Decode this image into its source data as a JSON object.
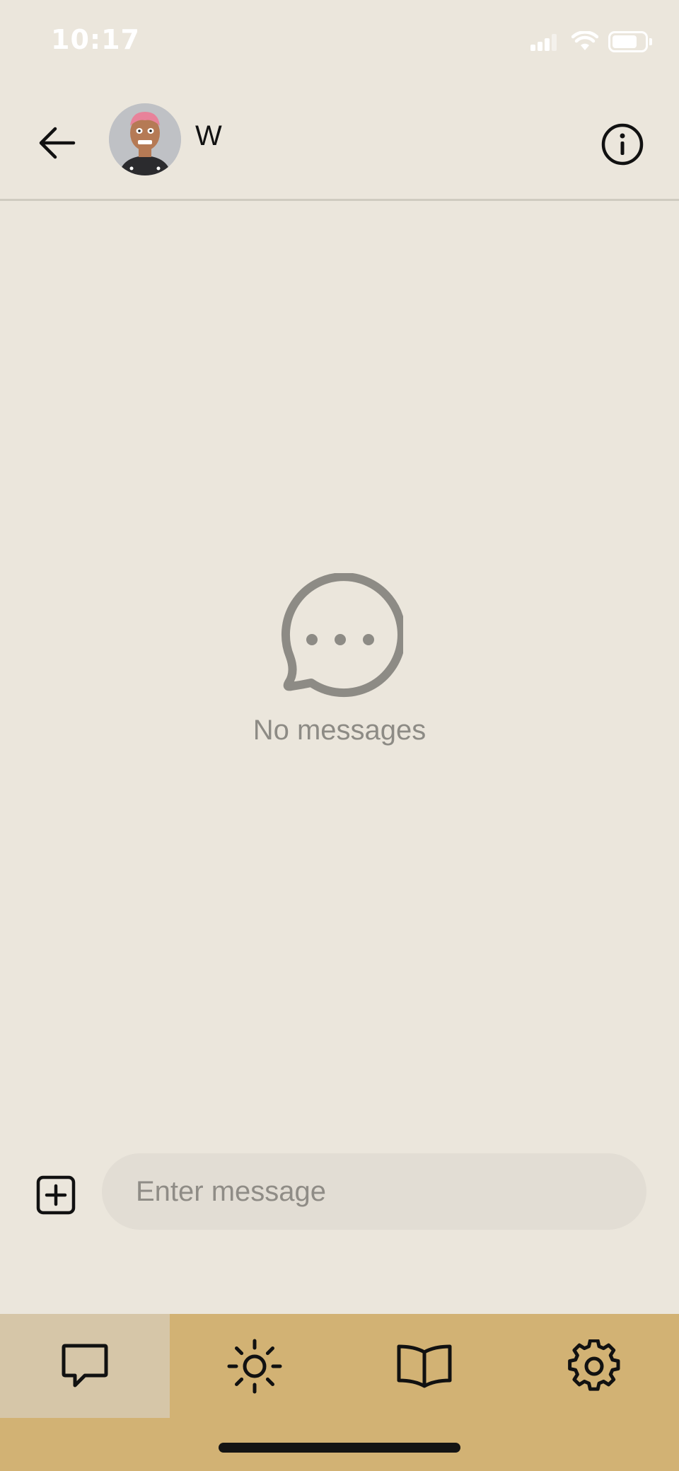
{
  "status_bar": {
    "time": "10:17",
    "signal_icon": "cellular-signal-icon",
    "wifi_icon": "wifi-icon",
    "battery_icon": "battery-icon",
    "status_color": "#ffffff"
  },
  "header": {
    "back_icon": "arrow-left-icon",
    "contact_name": "W",
    "avatar": "contact-avatar",
    "info_icon": "info-circle-icon"
  },
  "empty_state": {
    "icon": "chat-bubble-dots-icon",
    "label": "No messages"
  },
  "composer": {
    "attach_icon": "plus-square-icon",
    "placeholder": "Enter message",
    "value": ""
  },
  "tab_bar": {
    "tabs": [
      {
        "icon": "chat-icon",
        "active": true
      },
      {
        "icon": "sun-icon",
        "active": false
      },
      {
        "icon": "book-icon",
        "active": false
      },
      {
        "icon": "gear-icon",
        "active": false
      }
    ]
  },
  "colors": {
    "background": "#ebe6dc",
    "tab_bar": "#d2b274",
    "active_tab": "#d6c6a8",
    "input_background": "#e2ddd4",
    "muted_text": "#8d8b85"
  }
}
